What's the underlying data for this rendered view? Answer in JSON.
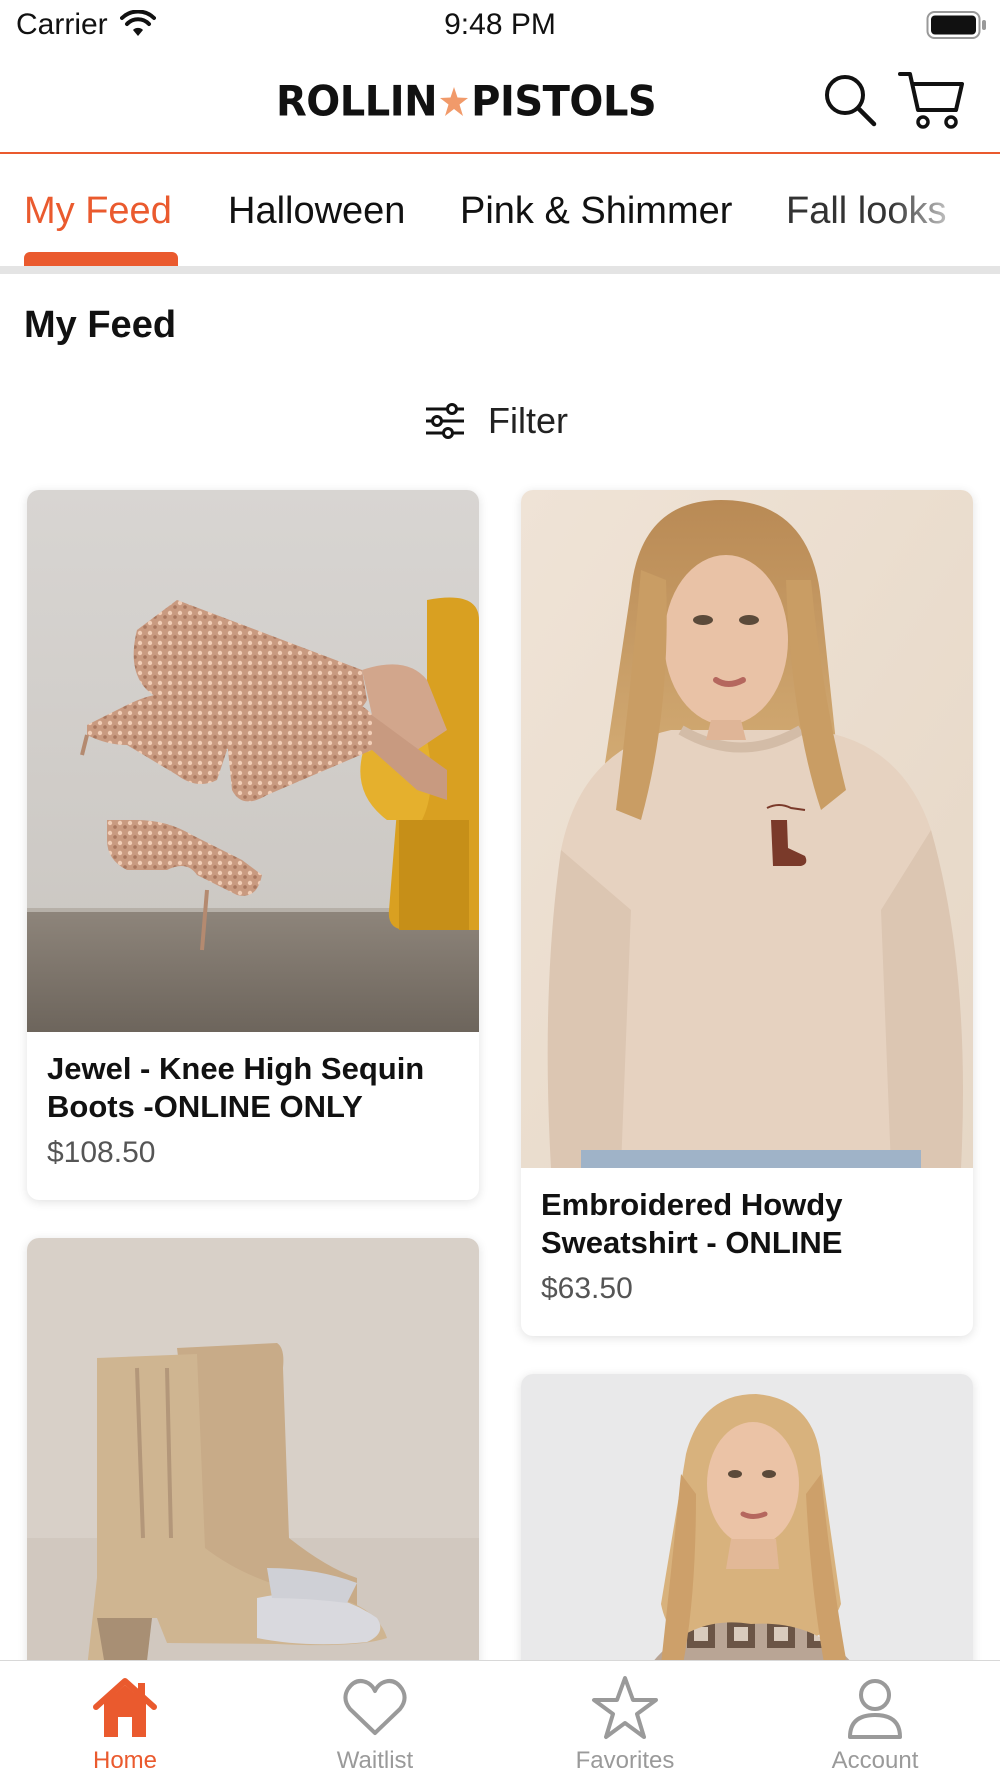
{
  "status_bar": {
    "carrier": "Carrier",
    "time": "9:48 PM",
    "wifi_icon": "wifi-icon",
    "battery_icon": "battery-icon"
  },
  "header": {
    "logo_left": "ROLLIN",
    "logo_right": "PISTOLS",
    "search_icon": "search-icon",
    "cart_icon": "cart-icon"
  },
  "tabs": [
    {
      "label": "My Feed",
      "active": true
    },
    {
      "label": "Halloween",
      "active": false
    },
    {
      "label": "Pink & Shimmer",
      "active": false
    },
    {
      "label": "Fall looks",
      "active": false
    }
  ],
  "section_title": "My Feed",
  "filter": {
    "label": "Filter",
    "icon": "sliders-icon"
  },
  "products": [
    {
      "name": "Jewel - Knee High Sequin Boots -ONLINE ONLY",
      "price": "$108.50"
    },
    {
      "name": "Embroidered Howdy Sweatshirt - ONLINE",
      "price": "$63.50"
    }
  ],
  "bottom_nav": [
    {
      "label": "Home",
      "icon": "home-icon",
      "active": true
    },
    {
      "label": "Waitlist",
      "icon": "heart-icon",
      "active": false
    },
    {
      "label": "Favorites",
      "icon": "star-icon",
      "active": false
    },
    {
      "label": "Account",
      "icon": "person-icon",
      "active": false
    }
  ],
  "colors": {
    "accent": "#ea5a2e",
    "text": "#111111",
    "muted": "#9a9a9a"
  }
}
